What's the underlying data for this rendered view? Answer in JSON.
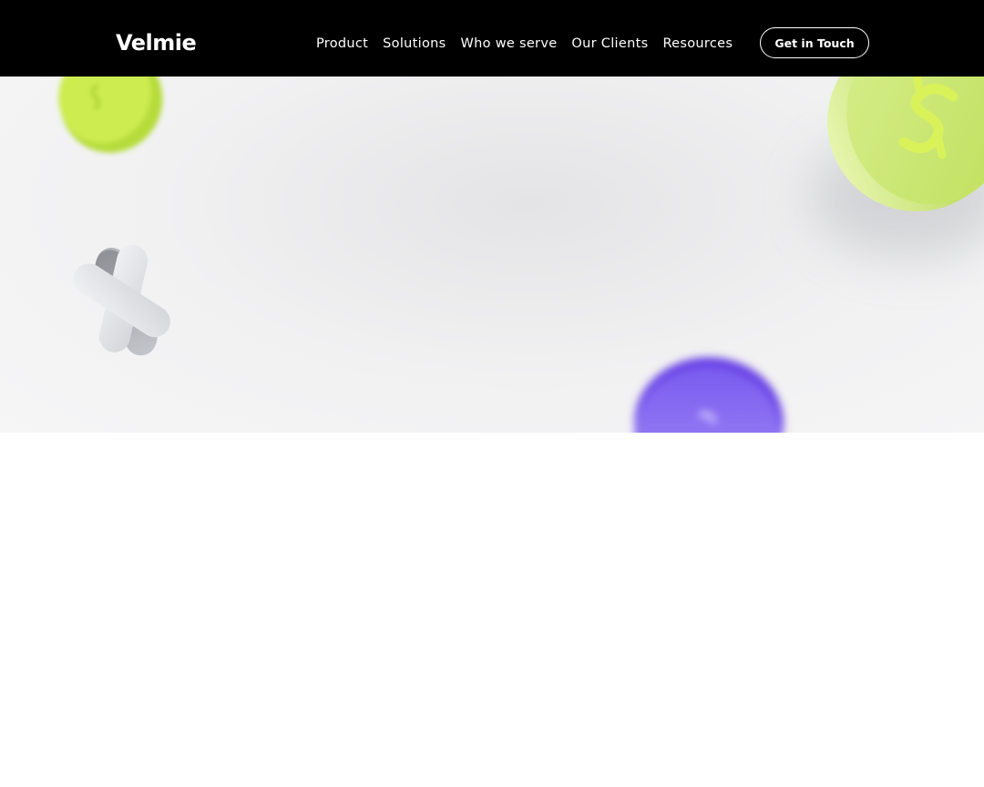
{
  "header": {
    "logo": "Velmie",
    "nav": [
      {
        "label": "Product"
      },
      {
        "label": "Solutions"
      },
      {
        "label": "Who we serve"
      },
      {
        "label": "Our Clients"
      },
      {
        "label": "Resources"
      }
    ],
    "cta_label": "Get in Touch"
  },
  "hero": {
    "decorations": [
      "dollar-coin-icon",
      "dollar-coin-icon",
      "x-shape-icon",
      "dollar-coin-icon"
    ],
    "colors": {
      "green_coin": "#c8e86a",
      "purple_coin": "#8b6cf0",
      "silver_x": "#d9dadd",
      "background": "#f1f1f2"
    }
  },
  "colors": {
    "navbar": "#000000",
    "nav_text": "#ffffff"
  }
}
